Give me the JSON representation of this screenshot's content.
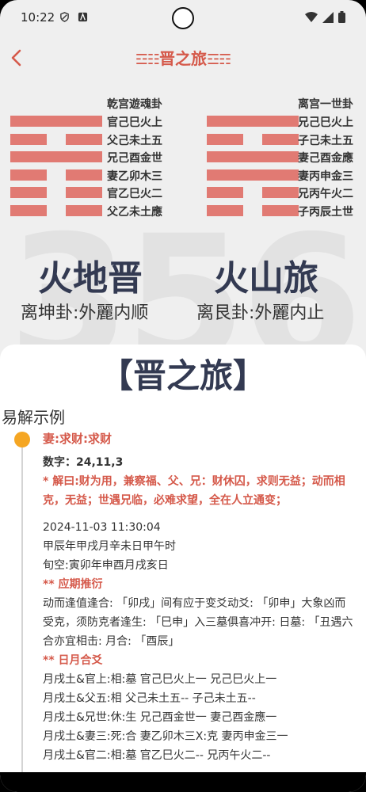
{
  "status": {
    "time": "10:22"
  },
  "header": {
    "title": "晋之旅",
    "title_deco_left": "☲☷",
    "title_deco_right": "☲☶"
  },
  "watermark": "356",
  "left_hex": {
    "header": "乾宫遊魂卦",
    "lines": [
      {
        "text": "官己巳火上",
        "yin": false
      },
      {
        "text": "父己未土五",
        "yin": true
      },
      {
        "text": "兄己酉金世",
        "yin": false
      },
      {
        "text": "妻乙卯木三",
        "yin": true
      },
      {
        "text": "官乙巳火二",
        "yin": true
      },
      {
        "text": "父乙未土應",
        "yin": true
      }
    ],
    "name": "火地晋",
    "desc": "离坤卦:外麗内顺"
  },
  "right_hex": {
    "header": "离宫一世卦",
    "lines": [
      {
        "text": "兄己巳火上",
        "yin": false
      },
      {
        "text": "子己未土五",
        "yin": true
      },
      {
        "text": "妻己酉金應",
        "yin": false
      },
      {
        "text": "妻丙申金三",
        "yin": false
      },
      {
        "text": "兄丙午火二",
        "yin": true
      },
      {
        "text": "子丙辰土世",
        "yin": true
      }
    ],
    "name": "火山旅",
    "desc": "离艮卦:外麗内止"
  },
  "card": {
    "title": "【晋之旅】",
    "section": "易解示例",
    "entry_title": "妻:求财:求财",
    "numbers": "数字：24,11,3",
    "judgement": "* 解曰:财为用，兼察福、父、兄：财休囚，求则无益；动而相克，无益；世遇兄临，必难求望，全在人立通变；",
    "datetime": "2024-11-03 11:30:04",
    "ganzhi": "甲辰年甲戌月辛未日甲午时",
    "xunkong": "旬空:寅卯年申酉月戌亥日",
    "yingqi_head": "** 应期推衍",
    "yingqi_text": "动而逢值逢合: 「卯戌」间有应于变爻动爻: 「卯申」大象凶而受克，须防克者逢生: 「巳申」入三墓俱喜冲开: 日墓: 「丑遇六合亦宜相击: 月合: 「酉辰」",
    "riyue_head": "** 日月合爻",
    "riyue_lines": [
      "月戌土&官上:相:墓  官己巳火上一  兄己巳火上一",
      "月戌土&父五:相  父己未土五--  子己未土五--",
      "月戌土&兄世:休:生  兄己酉金世一  妻己酉金應一",
      "月戌土&妻三:死:合  妻乙卯木三X:克  妻丙申金三一",
      "月戌土&官二:相:墓  官乙巳火二--  兄丙午火二--"
    ]
  }
}
